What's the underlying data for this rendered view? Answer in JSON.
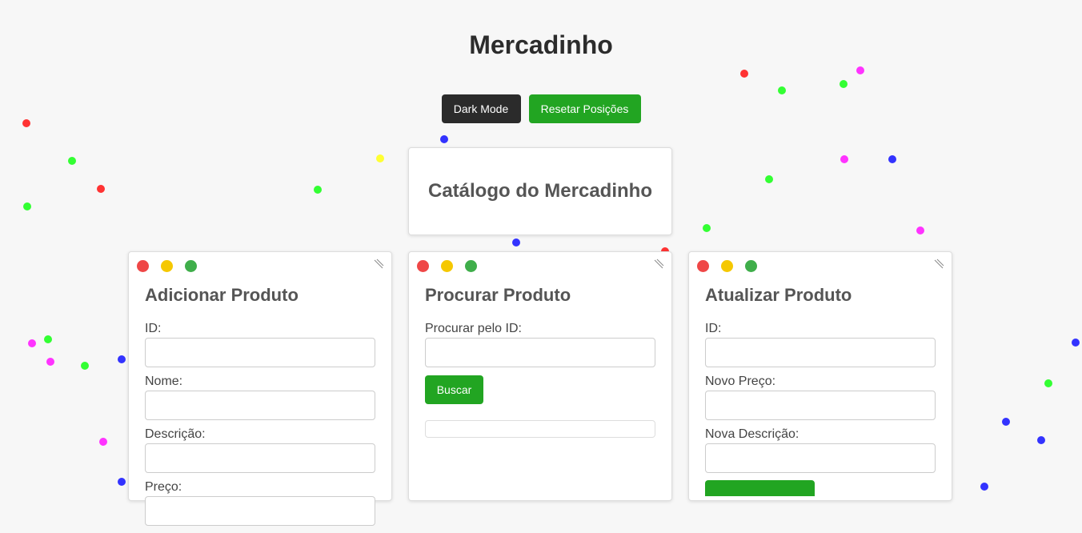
{
  "app": {
    "title": "Mercadinho"
  },
  "toolbar": {
    "dark_mode_label": "Dark Mode",
    "reset_label": "Resetar Posições"
  },
  "catalog": {
    "title": "Catálogo do Mercadinho"
  },
  "panels": {
    "add": {
      "title": "Adicionar Produto",
      "fields": [
        {
          "label": "ID:",
          "value": ""
        },
        {
          "label": "Nome:",
          "value": ""
        },
        {
          "label": "Descrição:",
          "value": ""
        },
        {
          "label": "Preço:",
          "value": ""
        }
      ]
    },
    "search": {
      "title": "Procurar Produto",
      "field_label": "Procurar pelo ID:",
      "field_value": "",
      "button_label": "Buscar",
      "result": ""
    },
    "update": {
      "title": "Atualizar Produto",
      "fields": [
        {
          "label": "ID:",
          "value": ""
        },
        {
          "label": "Novo Preço:",
          "value": ""
        },
        {
          "label": "Nova Descrição:",
          "value": ""
        }
      ]
    }
  },
  "colors": {
    "accent_green": "#22a522",
    "dark_button": "#2b2b2b",
    "window_red": "#ef4747",
    "window_yellow": "#f5c800",
    "window_green": "#3fae4a",
    "particle_colors": [
      "#ff3333",
      "#33ff33",
      "#3333ff",
      "#ff33ff",
      "#ffff33"
    ]
  }
}
